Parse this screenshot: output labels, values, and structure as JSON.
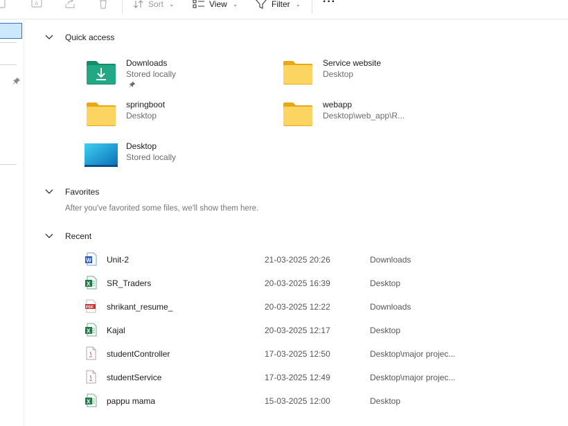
{
  "toolbar": {
    "sort_label": "Sort",
    "view_label": "View",
    "filter_label": "Filter",
    "more_label": "···"
  },
  "quick_access": {
    "title": "Quick access",
    "items": [
      {
        "name": "Downloads",
        "sub": "Stored locally",
        "icon": "downloads-folder-icon",
        "pinned": true
      },
      {
        "name": "Service website",
        "sub": "Desktop",
        "icon": "folder-icon"
      },
      {
        "name": "springboot",
        "sub": "Desktop",
        "icon": "folder-icon"
      },
      {
        "name": "webapp",
        "sub": "Desktop\\web_app\\R...",
        "icon": "folder-icon"
      },
      {
        "name": "Desktop",
        "sub": "Stored locally",
        "icon": "desktop-folder-icon"
      }
    ]
  },
  "favorites": {
    "title": "Favorites",
    "empty_message": "After you've favorited some files, we'll show them here."
  },
  "recent": {
    "title": "Recent",
    "files": [
      {
        "name": "Unit-2",
        "date": "21-03-2025 20:26",
        "location": "Downloads",
        "icon": "word-file-icon"
      },
      {
        "name": "SR_Traders",
        "date": "20-03-2025 16:39",
        "location": "Desktop",
        "icon": "excel-file-icon"
      },
      {
        "name": "shrikant_resume_",
        "date": "20-03-2025 12:22",
        "location": "Downloads",
        "icon": "pdf-file-icon"
      },
      {
        "name": "Kajal",
        "date": "20-03-2025 12:17",
        "location": "Desktop",
        "icon": "excel-file-icon"
      },
      {
        "name": "studentController",
        "date": "17-03-2025 12:50",
        "location": "Desktop\\major projec...",
        "icon": "java-file-icon"
      },
      {
        "name": "studentService",
        "date": "17-03-2025 12:49",
        "location": "Desktop\\major projec...",
        "icon": "java-file-icon"
      },
      {
        "name": "pappu mama",
        "date": "15-03-2025 12:00",
        "location": "Desktop",
        "icon": "excel-file-icon"
      }
    ]
  },
  "colors": {
    "accent": "#0067c0",
    "folder_yellow": "#f8c84a",
    "downloads_green": "#1b9a78",
    "selection": "#cce8ff"
  }
}
